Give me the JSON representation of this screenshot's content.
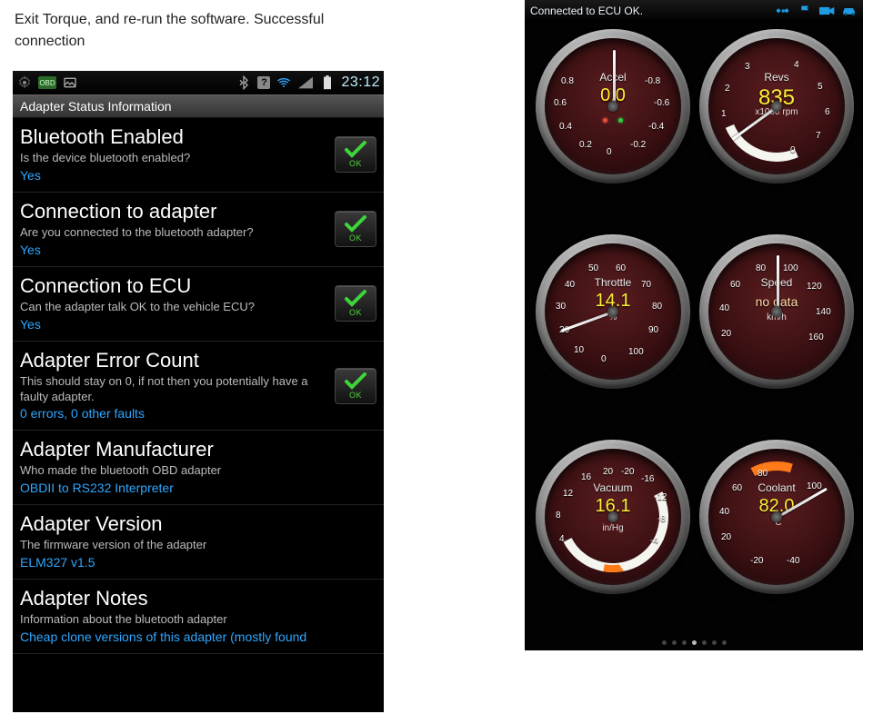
{
  "instruction": "Exit Torque, and re-run the software. Successful connection",
  "left": {
    "status": {
      "time": "23:12"
    },
    "section_header": "Adapter Status Information",
    "items": [
      {
        "title": "Bluetooth Enabled",
        "desc": "Is the device bluetooth enabled?",
        "value": "Yes",
        "ok": true
      },
      {
        "title": "Connection to adapter",
        "desc": "Are you connected to the bluetooth adapter?",
        "value": "Yes",
        "ok": true
      },
      {
        "title": "Connection to ECU",
        "desc": "Can the adapter talk OK to the vehicle ECU?",
        "value": "Yes",
        "ok": true
      },
      {
        "title": "Adapter Error Count",
        "desc": "This should stay on 0, if not then you potentially have a faulty adapter.",
        "value": "0 errors, 0 other faults",
        "ok": true
      },
      {
        "title": "Adapter Manufacturer",
        "desc": "Who made the bluetooth OBD adapter",
        "value": "OBDII to RS232 Interpreter",
        "ok": false
      },
      {
        "title": "Adapter Version",
        "desc": "The firmware version of the adapter",
        "value": "ELM327 v1.5",
        "ok": false
      },
      {
        "title": "Adapter Notes",
        "desc": "Information about the bluetooth adapter",
        "value": "Cheap clone versions of this adapter (mostly found",
        "ok": false
      }
    ],
    "ok_label": "OK"
  },
  "right": {
    "status_text": "Connected to ECU OK.",
    "gauges": {
      "accel": {
        "label": "Accel",
        "value": "0.0",
        "unit": "",
        "ticks": [
          "0.8",
          "0.6",
          "0.4",
          "0.2",
          "0",
          "-0.2",
          "-0.4",
          "-0.6",
          "-0.8"
        ],
        "needle_deg": 0
      },
      "revs": {
        "label": "Revs",
        "value": "835",
        "unit": "x1000 rpm",
        "ticks": [
          "1",
          "2",
          "3",
          "4",
          "5",
          "6",
          "7",
          "0"
        ],
        "needle_deg": -126
      },
      "throttle": {
        "label": "Throttle",
        "value": "14.1",
        "unit": "%",
        "ticks": [
          "10",
          "20",
          "30",
          "40",
          "50",
          "60",
          "70",
          "80",
          "90",
          "0",
          "100"
        ],
        "needle_deg": -110
      },
      "speed": {
        "label": "Speed",
        "value": "no data",
        "unit": "km/h",
        "ticks": [
          "20",
          "40",
          "60",
          "80",
          "100",
          "120",
          "140",
          "160"
        ],
        "needle_deg": 0
      },
      "vacuum": {
        "label": "Vacuum",
        "value": "16.1",
        "unit": "in/Hg",
        "ticks": [
          "4",
          "8",
          "12",
          "16",
          "20",
          "-20",
          "-16",
          "-12",
          "-8",
          "-4"
        ],
        "needle_deg": 35
      },
      "coolant": {
        "label": "Coolant",
        "value": "82.0",
        "unit": "°C",
        "ticks": [
          "20",
          "40",
          "60",
          "80",
          "100",
          "-20",
          "-40"
        ],
        "needle_deg": 60
      }
    },
    "pager": {
      "count": 7,
      "active": 3
    }
  }
}
